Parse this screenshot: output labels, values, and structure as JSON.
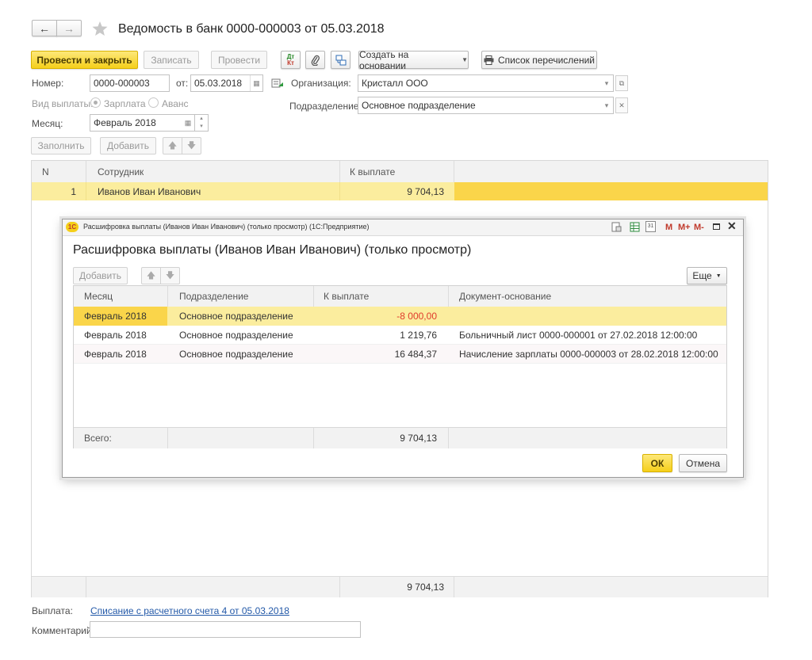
{
  "window": {
    "nav_back": "←",
    "nav_forward": "→",
    "title": "Ведомость в банк 0000-000003 от 05.03.2018"
  },
  "toolbar": {
    "post_close": "Провести и закрыть",
    "save": "Записать",
    "post": "Провести",
    "dt_kt_top": "Дт",
    "dt_kt_bottom": "Кт",
    "create_based": "Создать на основании",
    "list_transfers": "Список перечислений"
  },
  "form": {
    "number_label": "Номер:",
    "number_value": "0000-000003",
    "date_label": "от:",
    "date_value": "05.03.2018",
    "org_label": "Организация:",
    "org_value": "Кристалл ООО",
    "paytype_label": "Вид выплаты:",
    "paytype_salary": "Зарплата",
    "paytype_advance": "Аванс",
    "dept_label": "Подразделение:",
    "dept_value": "Основное подразделение",
    "month_label": "Месяц:",
    "month_value": "Февраль 2018"
  },
  "table_toolbar": {
    "fill": "Заполнить",
    "add": "Добавить"
  },
  "main_table": {
    "headers": [
      "N",
      "Сотрудник",
      "К выплате"
    ],
    "rows": [
      {
        "n": "1",
        "employee": "Иванов Иван Иванович",
        "amount": "9 704,13"
      }
    ],
    "footer_total": "9 704,13"
  },
  "footer": {
    "payment_label": "Выплата:",
    "payment_link": "Списание с расчетного счета 4 от 05.03.2018",
    "comment_label": "Комментарий:",
    "comment_value": ""
  },
  "dialog": {
    "window_title": "Расшифровка выплаты (Иванов Иван Иванович) (только просмотр)  (1С:Предприятие)",
    "logo": "1С",
    "title": "Расшифровка выплаты (Иванов Иван Иванович) (только просмотр)",
    "titlebar_buttons": {
      "m": "M",
      "mplus": "M+",
      "mminus": "M-",
      "calendar_day": "31"
    },
    "add": "Добавить",
    "more": "Еще",
    "headers": [
      "Месяц",
      "Подразделение",
      "К выплате",
      "Документ-основание"
    ],
    "rows": [
      {
        "month": "Февраль 2018",
        "dept": "Основное подразделение",
        "amount": "-8 000,00",
        "doc": ""
      },
      {
        "month": "Февраль 2018",
        "dept": "Основное подразделение",
        "amount": "1 219,76",
        "doc": "Больничный лист 0000-000001 от 27.02.2018 12:00:00"
      },
      {
        "month": "Февраль 2018",
        "dept": "Основное подразделение",
        "amount": "16 484,37",
        "doc": "Начисление зарплаты 0000-000003 от 28.02.2018 12:00:00"
      }
    ],
    "total_label": "Всего:",
    "total_value": "9 704,13",
    "ok": "ОК",
    "cancel": "Отмена"
  },
  "colors": {
    "accent_yellow": "#f5cf1a",
    "row_selected": "#fbed9e",
    "cell_current": "#fad54a",
    "negative": "#e03b2c",
    "link": "#2359a8"
  }
}
